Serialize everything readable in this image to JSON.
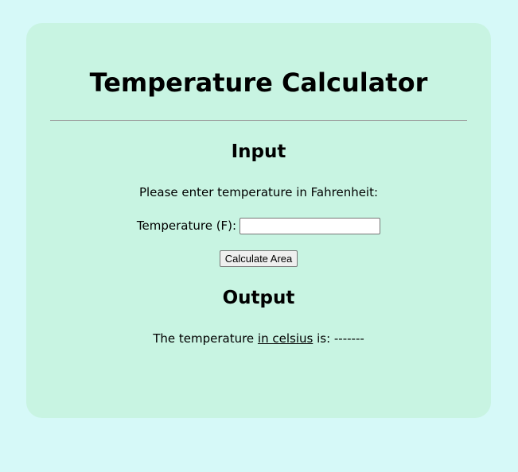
{
  "page": {
    "title": "Temperature Calculator"
  },
  "input_section": {
    "heading": "Input",
    "instruction": "Please enter temperature in Fahrenheit:",
    "temperature_label": "Temperature (F):",
    "temperature_value": "",
    "calculate_button_label": "Calculate Area"
  },
  "output_section": {
    "heading": "Output",
    "result_prefix": "The temperature ",
    "result_emphasis": "in celsius",
    "result_middle": " is: ",
    "result_value": "-------"
  },
  "colors": {
    "page_background": "#d6f9f8",
    "card_background": "#c8f4e2",
    "divider": "#9a9a9a"
  }
}
